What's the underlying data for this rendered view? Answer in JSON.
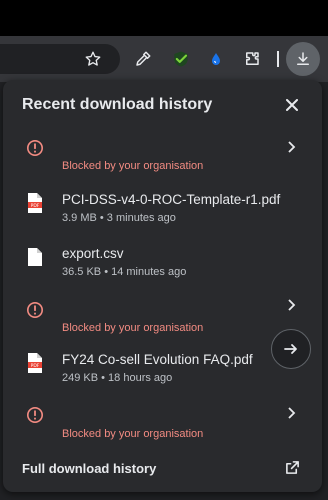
{
  "toolbar": {
    "icons": [
      "star-icon",
      "eyedropper-icon",
      "check-shield-icon",
      "water-drop-icon",
      "extensions-puzzle-icon",
      "downloads-icon"
    ]
  },
  "panel": {
    "title": "Recent download history",
    "items": [
      {
        "type": "blocked",
        "status": "Blocked by your organisation"
      },
      {
        "type": "pdf",
        "name": "PCI-DSS-v4-0-ROC-Template-r1.pdf",
        "meta": "3.9 MB • 3 minutes ago"
      },
      {
        "type": "file",
        "name": "export.csv",
        "meta": "36.5 KB • 14 minutes ago"
      },
      {
        "type": "blocked",
        "status": "Blocked by your organisation"
      },
      {
        "type": "pdf",
        "name": "FY24 Co-sell Evolution FAQ.pdf",
        "meta": "249 KB • 18 hours ago"
      },
      {
        "type": "blocked",
        "status": "Blocked by your organisation"
      }
    ],
    "footer": "Full download history"
  },
  "colors": {
    "accent_red": "#f28b82",
    "panel_bg": "#292a2d",
    "pdf_red": "#ea4335"
  }
}
